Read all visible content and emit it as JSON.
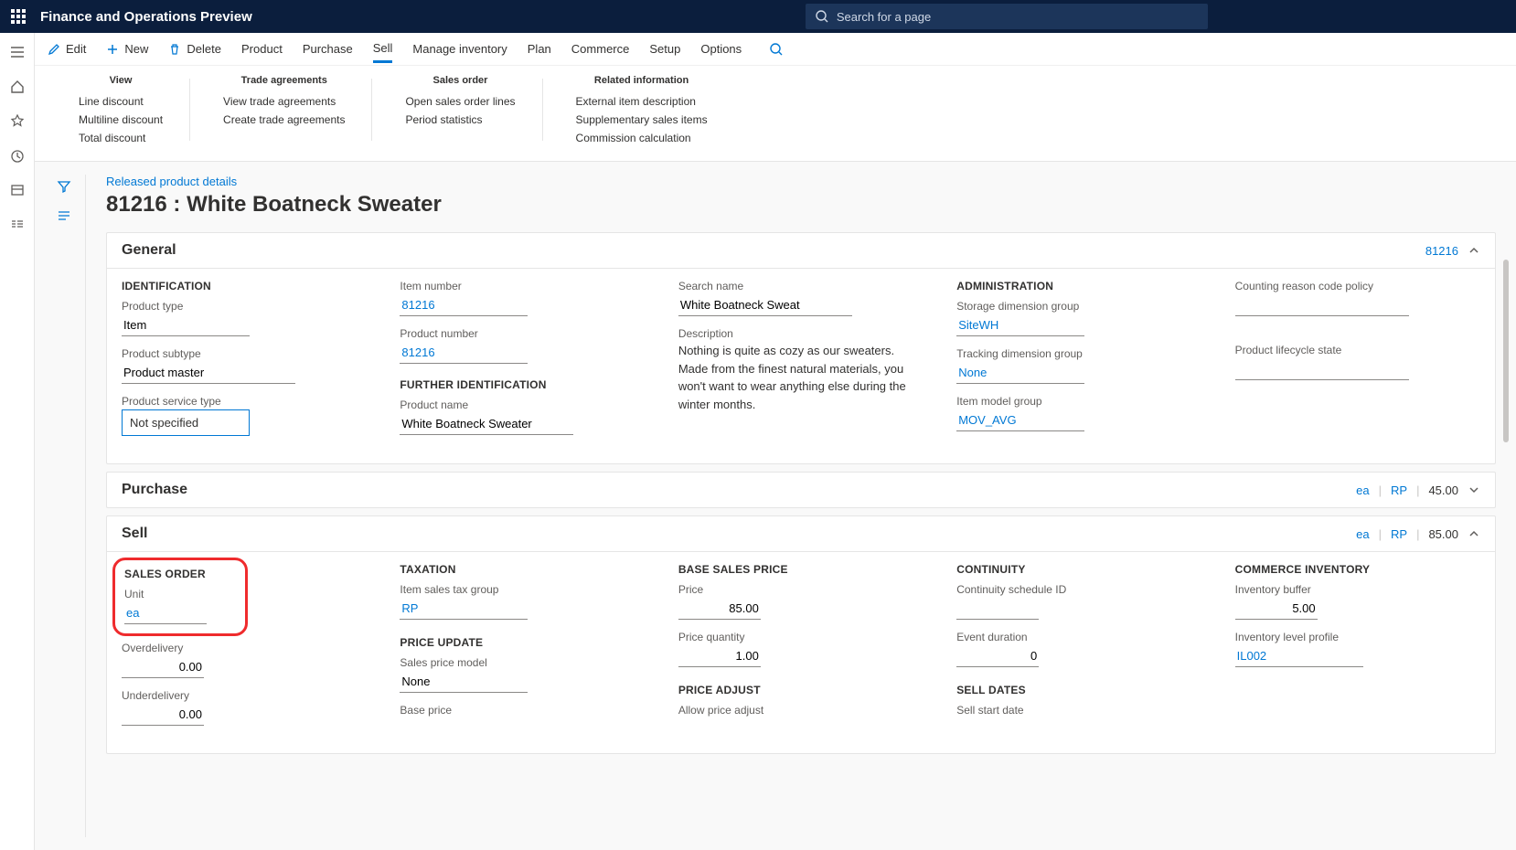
{
  "header": {
    "app_title": "Finance and Operations Preview",
    "search_placeholder": "Search for a page"
  },
  "action_bar": {
    "edit": "Edit",
    "new": "New",
    "delete": "Delete",
    "tabs": [
      "Product",
      "Purchase",
      "Sell",
      "Manage inventory",
      "Plan",
      "Commerce",
      "Setup",
      "Options"
    ],
    "active_tab": "Sell"
  },
  "sub_ribbon": {
    "cols": [
      {
        "head": "View",
        "links": [
          "Line discount",
          "Multiline discount",
          "Total discount"
        ]
      },
      {
        "head": "Trade agreements",
        "links": [
          "View trade agreements",
          "Create trade agreements"
        ]
      },
      {
        "head": "Sales order",
        "links": [
          "Open sales order lines",
          "Period statistics"
        ]
      },
      {
        "head": "Related information",
        "links": [
          "External item description",
          "Supplementary sales items",
          "Commission calculation"
        ]
      }
    ]
  },
  "page": {
    "breadcrumb": "Released product details",
    "title": "81216 : White Boatneck Sweater"
  },
  "general": {
    "header": "General",
    "header_right": "81216",
    "identification": {
      "head": "IDENTIFICATION",
      "product_type_label": "Product type",
      "product_type": "Item",
      "product_subtype_label": "Product subtype",
      "product_subtype": "Product master",
      "product_service_type_label": "Product service type",
      "product_service_type": "Not specified"
    },
    "item": {
      "item_number_label": "Item number",
      "item_number": "81216",
      "product_number_label": "Product number",
      "product_number": "81216",
      "further_head": "FURTHER IDENTIFICATION",
      "product_name_label": "Product name",
      "product_name": "White Boatneck Sweater"
    },
    "search": {
      "search_name_label": "Search name",
      "search_name": "White Boatneck Sweat",
      "description_label": "Description",
      "description": "Nothing is quite as cozy as our sweaters. Made from the finest natural materials, you won't want to wear anything else during the winter months."
    },
    "admin": {
      "head": "ADMINISTRATION",
      "storage_label": "Storage dimension group",
      "storage": "SiteWH",
      "tracking_label": "Tracking dimension group",
      "tracking": "None",
      "item_model_label": "Item model group",
      "item_model": "MOV_AVG"
    },
    "right": {
      "counting_label": "Counting reason code policy",
      "lifecycle_label": "Product lifecycle state"
    }
  },
  "purchase": {
    "header": "Purchase",
    "unit": "ea",
    "group": "RP",
    "price": "45.00"
  },
  "sell": {
    "header": "Sell",
    "unit": "ea",
    "group": "RP",
    "price": "85.00",
    "sales_order": {
      "head": "SALES ORDER",
      "unit_label": "Unit",
      "unit": "ea",
      "overdelivery_label": "Overdelivery",
      "overdelivery": "0.00",
      "underdelivery_label": "Underdelivery",
      "underdelivery": "0.00"
    },
    "taxation": {
      "head": "TAXATION",
      "item_tax_label": "Item sales tax group",
      "item_tax": "RP",
      "price_update_head": "PRICE UPDATE",
      "sales_price_model_label": "Sales price model",
      "sales_price_model": "None",
      "base_price_label": "Base price"
    },
    "base_price": {
      "head": "BASE SALES PRICE",
      "price_label": "Price",
      "price": "85.00",
      "price_qty_label": "Price quantity",
      "price_qty": "1.00",
      "price_adjust_head": "PRICE ADJUST",
      "allow_adjust_label": "Allow price adjust"
    },
    "continuity": {
      "head": "CONTINUITY",
      "schedule_label": "Continuity schedule ID",
      "event_label": "Event duration",
      "event": "0",
      "sell_dates_head": "SELL DATES",
      "sell_start_label": "Sell start date"
    },
    "commerce": {
      "head": "COMMERCE INVENTORY",
      "buffer_label": "Inventory buffer",
      "buffer": "5.00",
      "level_label": "Inventory level profile",
      "level": "IL002"
    }
  }
}
